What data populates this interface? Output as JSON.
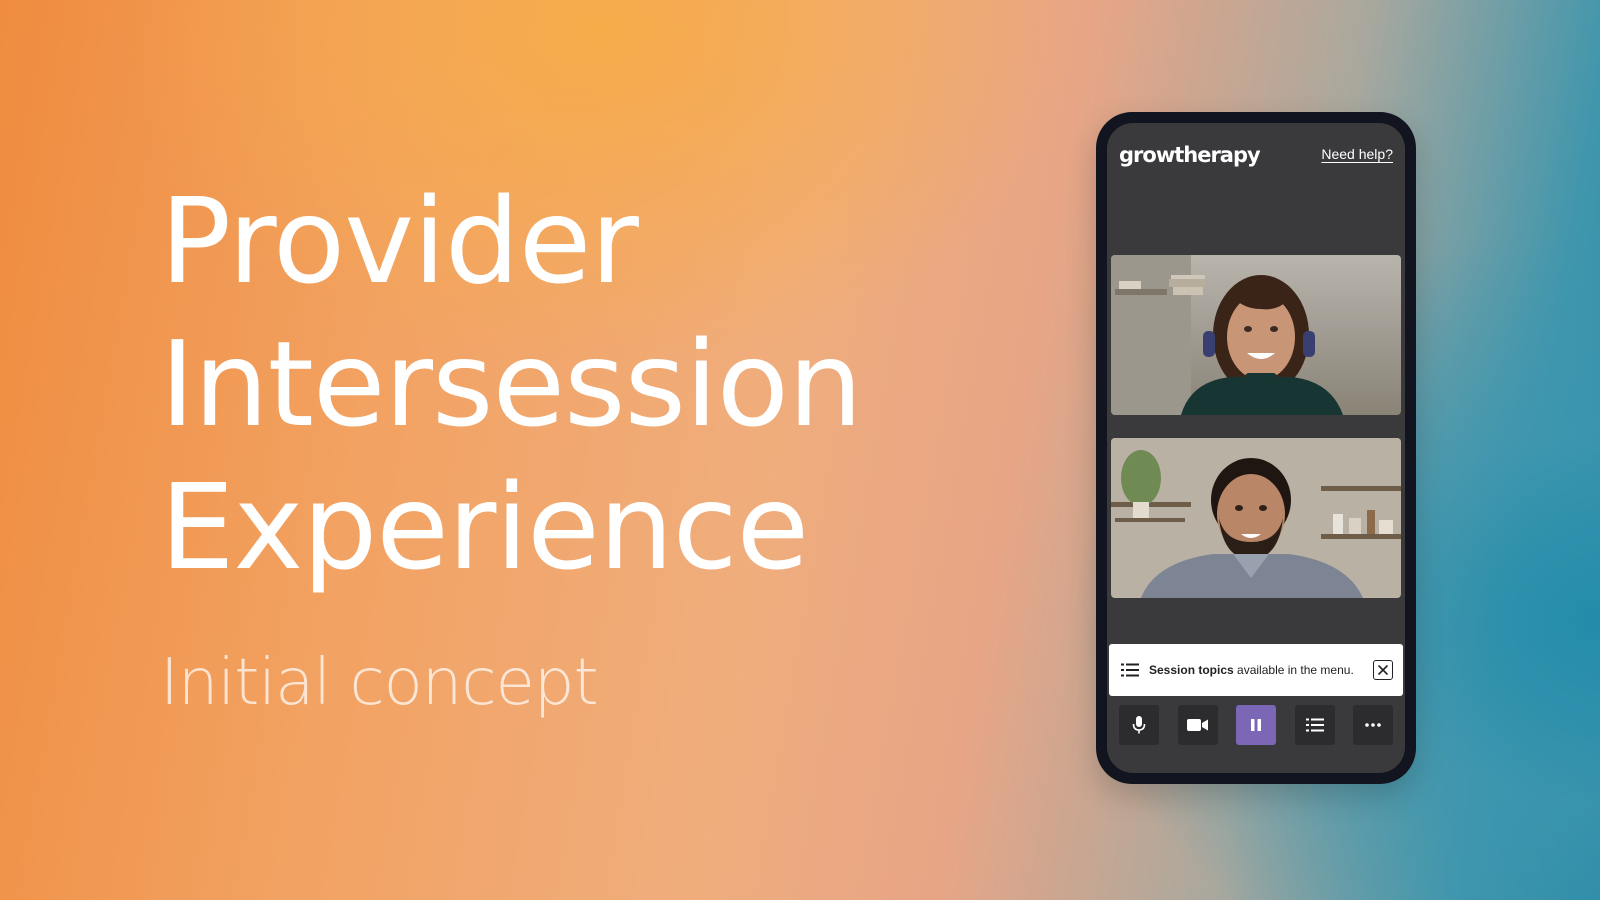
{
  "slide": {
    "title_lines": [
      "Provider",
      "Intersession",
      "Experience"
    ],
    "subtitle": "Initial concept"
  },
  "app": {
    "brand": "growtherapy",
    "help_link": "Need help?"
  },
  "toast": {
    "bold": "Session topics",
    "rest": " available in the menu."
  },
  "controls": [
    {
      "icon": "microphone-icon",
      "active": false
    },
    {
      "icon": "video-camera-icon",
      "active": false
    },
    {
      "icon": "pause-icon",
      "active": true
    },
    {
      "icon": "list-icon",
      "active": false
    },
    {
      "icon": "more-icon",
      "active": false
    }
  ],
  "colors": {
    "accent": "#7c66b6",
    "screen": "#3a3a3c",
    "button": "#2c2c2e"
  }
}
